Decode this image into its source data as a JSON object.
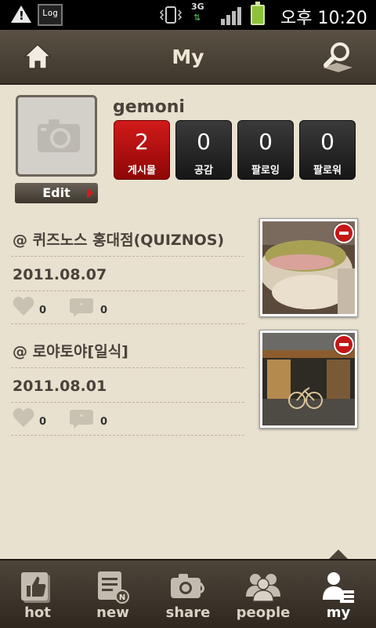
{
  "status_bar": {
    "warning_symbol": "!",
    "log_label": "Log",
    "network": "3G",
    "time": "오후 10:20"
  },
  "header": {
    "title": "My"
  },
  "profile": {
    "username": "gemoni",
    "edit_label": "Edit",
    "stats": [
      {
        "count": "2",
        "label": "게시물",
        "active": true
      },
      {
        "count": "0",
        "label": "공감",
        "active": false
      },
      {
        "count": "0",
        "label": "팔로잉",
        "active": false
      },
      {
        "count": "0",
        "label": "팔로워",
        "active": false
      }
    ]
  },
  "posts": [
    {
      "place": "@ 퀴즈노스 홍대점(QUIZNOS)",
      "date": "2011.08.07",
      "likes": "0",
      "comments": "0"
    },
    {
      "place": "@ 로야토야[일식]",
      "date": "2011.08.01",
      "likes": "0",
      "comments": "0"
    }
  ],
  "tabs": [
    {
      "label": "hot",
      "icon": "thumbs-up-icon"
    },
    {
      "label": "new",
      "icon": "new-notes-icon"
    },
    {
      "label": "share",
      "icon": "camera-share-icon"
    },
    {
      "label": "people",
      "icon": "people-icon"
    },
    {
      "label": "my",
      "icon": "my-profile-icon",
      "active": true
    }
  ],
  "colors": {
    "accent_red": "#c41616",
    "background": "#e8e1cf",
    "header": "#4a4236"
  }
}
